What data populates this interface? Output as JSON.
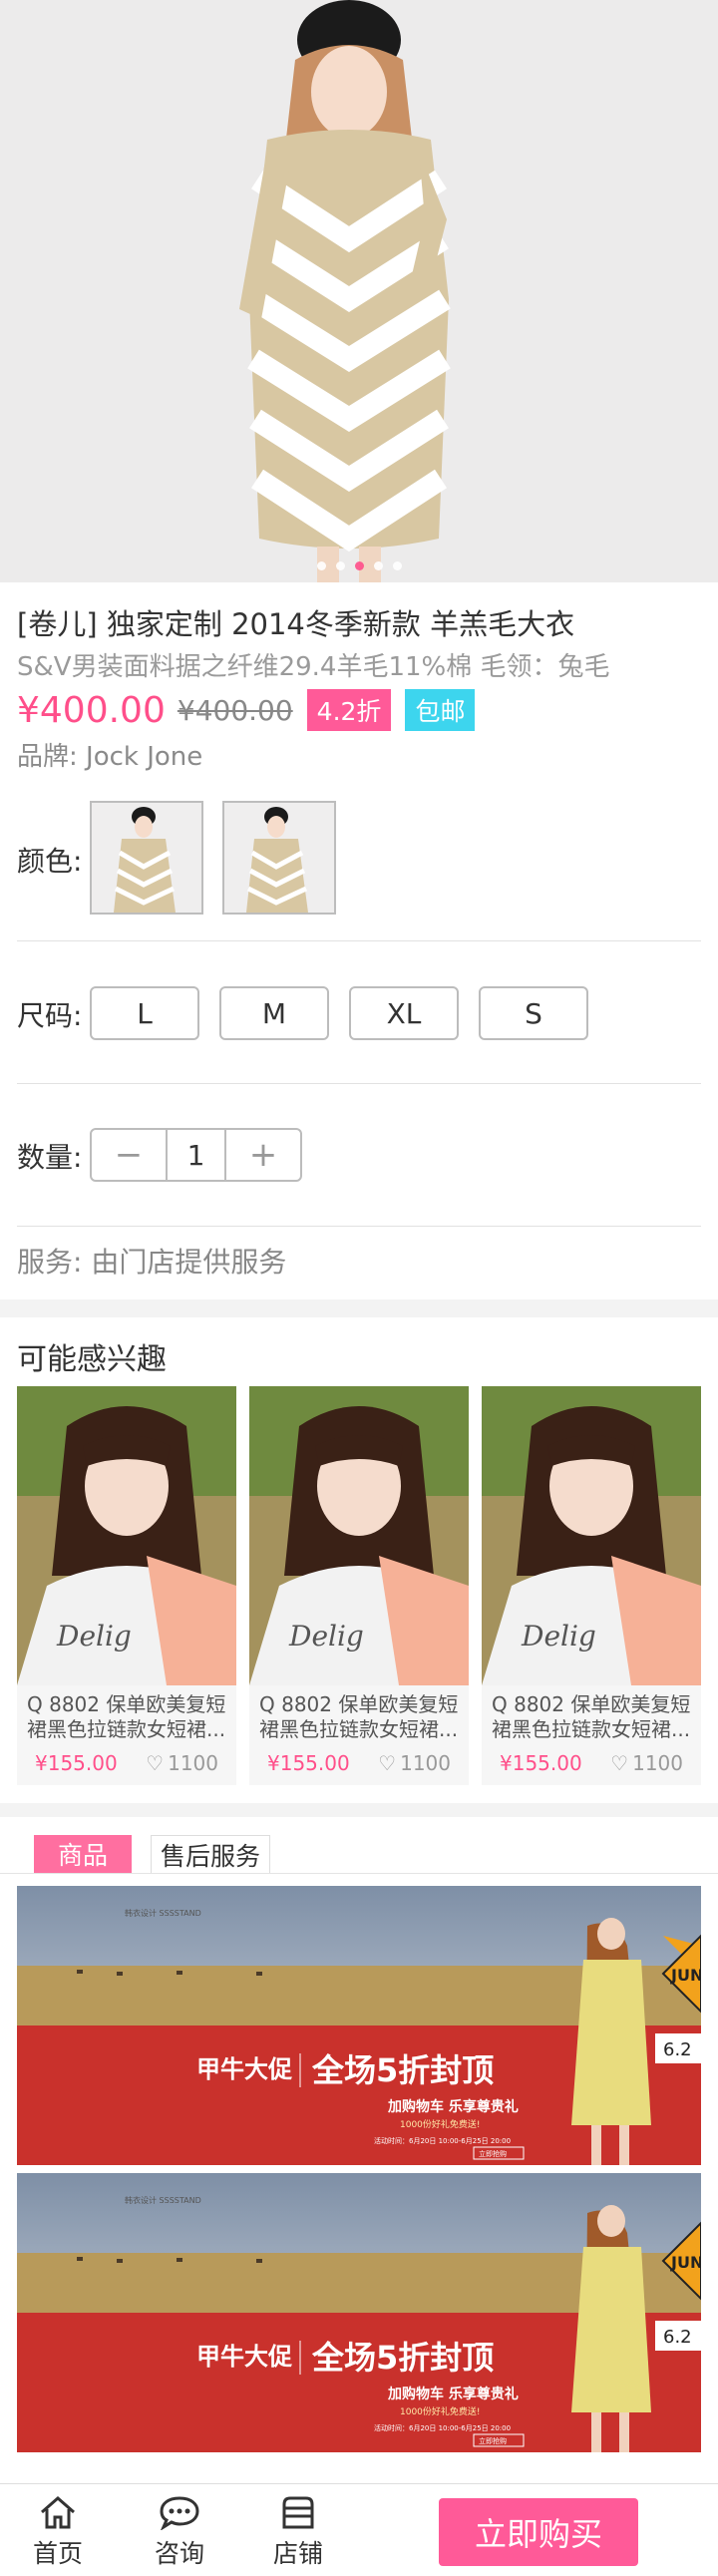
{
  "product": {
    "title": "[卷儿] 独家定制 2014冬季新款 羊羔毛大衣",
    "subtitle": "S&V男装面料据之纤维29.4羊毛11%棉 毛领：兔毛",
    "price": "¥400.00",
    "old_price": "¥400.00",
    "discount_badge": "4.2折",
    "shipping_badge": "包邮",
    "brand": "品牌: Jock Jone",
    "gallery_dots": 5,
    "gallery_active_index": 2
  },
  "options": {
    "color_label": "颜色:",
    "size_label": "尺码:",
    "sizes": [
      "L",
      "M",
      "XL",
      "S"
    ],
    "qty_label": "数量:",
    "qty_minus": "−",
    "qty_value": "1",
    "qty_plus": "+",
    "service": "服务: 由门店提供服务"
  },
  "recommend": {
    "title": "可能感兴趣",
    "items": [
      {
        "name1": "Q 8802 保单欧美复短",
        "name2": "裙黑色拉链款女短裙...",
        "price": "¥155.00",
        "likes": "1100"
      },
      {
        "name1": "Q 8802 保单欧美复短",
        "name2": "裙黑色拉链款女短裙...",
        "price": "¥155.00",
        "likes": "1100"
      },
      {
        "name1": "Q 8802 保单欧美复短",
        "name2": "裙黑色拉链款女短裙...",
        "price": "¥155.00",
        "likes": "1100"
      }
    ]
  },
  "tabs": {
    "goods": "商品",
    "after_sales": "售后服务"
  },
  "banner": {
    "logo": "韩衣设计 SSSSTAND",
    "brand_mark": "甲牛大促",
    "headline": "全场5折封顶",
    "subline": "加购物车 乐享尊贵礼",
    "small_line": "1000份好礼免费送!",
    "date_line": "活动时间：6月20日 10:00-6月25日 20:00",
    "cta": "立即抢购",
    "sign_text": "JUN",
    "sign_date": "6.2"
  },
  "bottom_nav": {
    "home": "首页",
    "consult": "咨询",
    "shop": "店铺",
    "buy": "立即购买"
  },
  "colors": {
    "accent_pink": "#ff4f8a",
    "badge_cyan": "#3dd5ee",
    "banner_red": "#c9312c"
  }
}
